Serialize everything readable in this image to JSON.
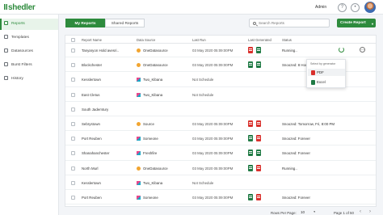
{
  "app": {
    "logo": "shedler"
  },
  "header": {
    "user": "Admin",
    "help_icon": "?",
    "notif_icon": "bell"
  },
  "sidebar": {
    "items": [
      {
        "label": "Reports",
        "icon": "reports-icon",
        "active": true
      },
      {
        "label": "Templates",
        "icon": "templates-icon"
      },
      {
        "label": "Datasources",
        "icon": "datasources-icon"
      },
      {
        "label": "Burst Filters",
        "icon": "burst-filters-icon"
      },
      {
        "label": "History",
        "icon": "history-icon"
      }
    ]
  },
  "main": {
    "tabs": [
      {
        "label": "My Reports"
      },
      {
        "label": "Shared Reports"
      }
    ],
    "search": {
      "placeholder": "Search Reports"
    },
    "create_button": "Create Report",
    "create_caret": "▾"
  },
  "table": {
    "headers": [
      "Report Name",
      "Data Source",
      "Last Run",
      "Last Generated",
      "Status"
    ],
    "rows": [
      {
        "name": "Tanyaryon Hold avesri..",
        "source": "OneDatasource",
        "source_type": "src",
        "last_run": "03 May 2020 05:09:00PM",
        "formats": [
          "pdf",
          "xls"
        ],
        "status": "Running.."
      },
      {
        "name": "Blockchester",
        "source": "OneDatasource",
        "source_type": "src",
        "last_run": "03 May 2020 05:09:00PM",
        "formats": [
          "xls",
          "xls"
        ],
        "status": "Snoozed: 8 Hour"
      },
      {
        "name": "Kesslertown",
        "source": "Two_Kibana",
        "source_type": "kib",
        "last_run": "Not Schedule",
        "formats": [],
        "status": ""
      },
      {
        "name": "East Cletus",
        "source": "Two_Kibana",
        "source_type": "kib",
        "last_run": "Not Schedule",
        "formats": [],
        "status": ""
      },
      {
        "name": "South Jademtury",
        "source": "",
        "source_type": "",
        "last_run": "",
        "formats": [],
        "status": ""
      },
      {
        "name": "Sebrystown",
        "source": "Source",
        "source_type": "src",
        "last_run": "03 May 2020 05:09:00PM",
        "formats": [
          "pdf",
          "pdf"
        ],
        "status": "Snoozed: Tomorrow, Fri, 8:00 PM"
      },
      {
        "name": "Port Reuben",
        "source": "Someone",
        "source_type": "kib",
        "last_run": "03 May 2020 05:09:00PM",
        "formats": [
          "xls",
          "pdf"
        ],
        "status": "Snoozed: Forever"
      },
      {
        "name": "Shanahanchester",
        "source": "Freshfire",
        "source_type": "kib",
        "last_run": "03 May 2020 05:09:00PM",
        "formats": [
          "xls",
          "xls"
        ],
        "status": "Snoozed: Forever"
      },
      {
        "name": "North Murl",
        "source": "OneDatasource",
        "source_type": "src",
        "last_run": "03 May 2020 05:09:00PM",
        "formats": [
          "xls",
          "pdf"
        ],
        "status": "Running.."
      },
      {
        "name": "Kesslertown",
        "source": "Two_Kibana",
        "source_type": "kib",
        "last_run": "Not Schedule",
        "formats": [],
        "status": ""
      },
      {
        "name": "Port Reuben",
        "source": "Someone",
        "source_type": "kib",
        "last_run": "03 May 2020 05:09:00PM",
        "formats": [
          "xls",
          "pdf"
        ],
        "status": "Snoozed: Forever"
      }
    ]
  },
  "dropdown": {
    "header": "Select by generator",
    "items": [
      {
        "label": "PDF",
        "color": "#d9302c"
      },
      {
        "label": "Excel",
        "color": "#1f7a44"
      }
    ]
  },
  "pager": {
    "rows_label": "Rows Per Page:",
    "rows_value": "10",
    "page_text": "Page 1 of 50",
    "prev": "‹",
    "next": "›",
    "caret": "▾"
  },
  "colors": {
    "brand": "#2e8b3d",
    "pdf": "#d9302c",
    "excel": "#1f7a44"
  }
}
